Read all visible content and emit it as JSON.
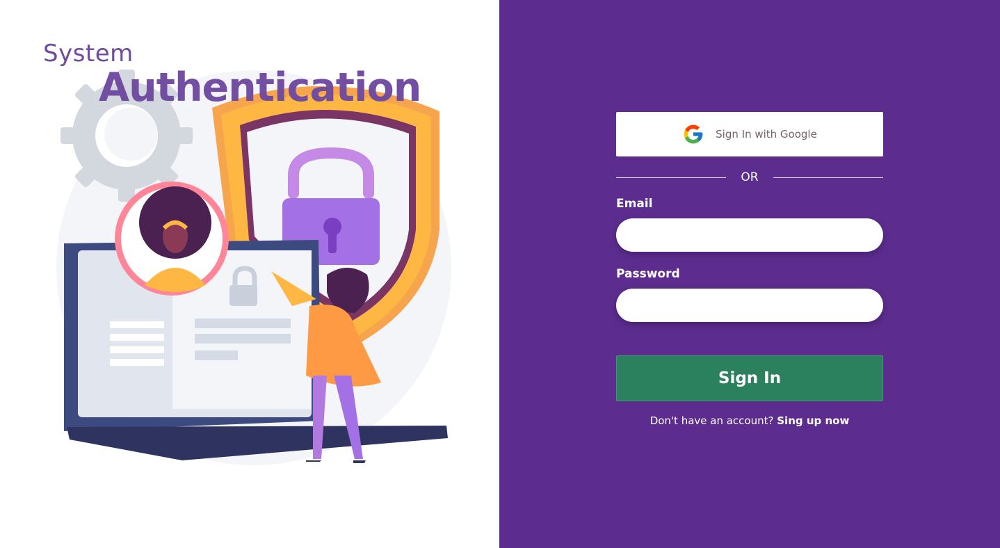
{
  "hero": {
    "title_small": "System",
    "title_big": "Authentication",
    "illustration_icon": "security-login-illustration"
  },
  "form": {
    "google_button_label": "Sign In with Google",
    "google_icon": "google-logo-icon",
    "divider_text": "OR",
    "email_label": "Email",
    "email_value": "",
    "password_label": "Password",
    "password_value": "",
    "submit_label": "Sign In",
    "signup_prompt": "Don't have an account?",
    "signup_link": "Sing up now"
  },
  "colors": {
    "panel_background": "#5c2d8e",
    "title": "#6e4aa0",
    "submit_button": "#2b805e"
  }
}
